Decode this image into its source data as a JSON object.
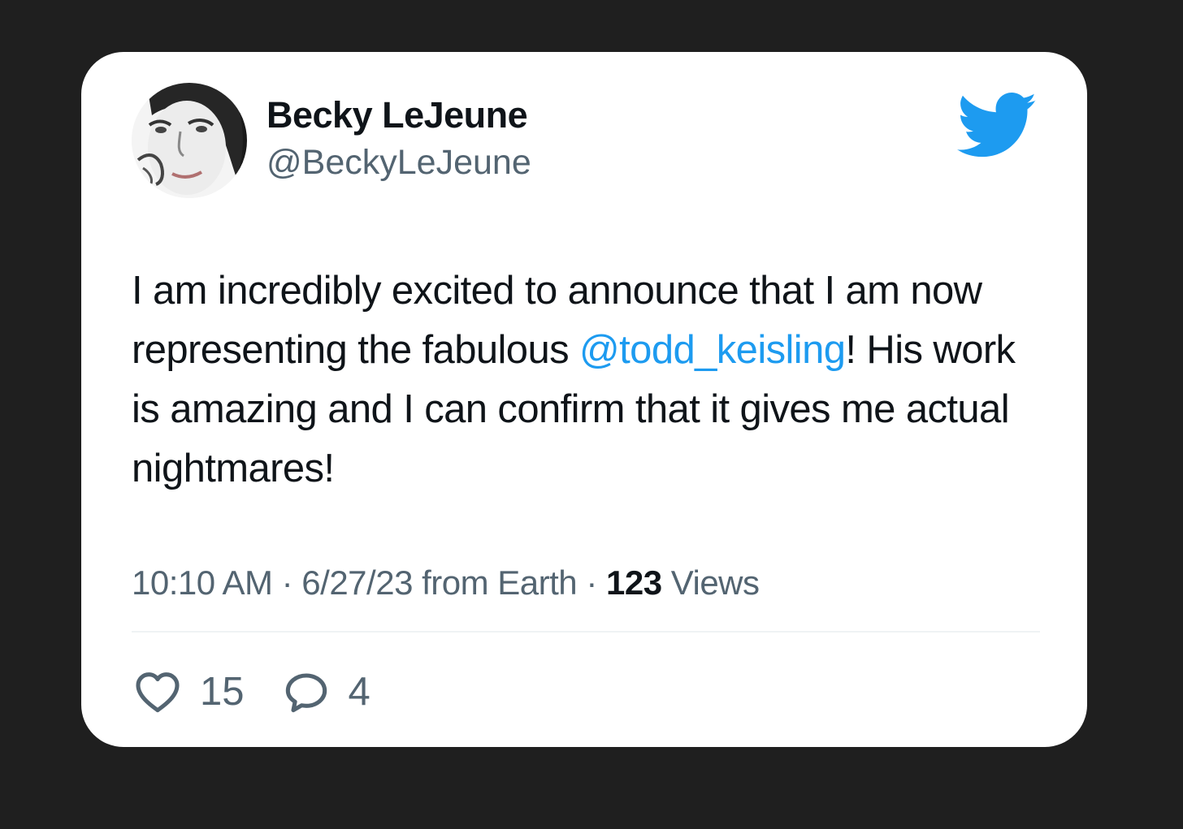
{
  "tweet": {
    "author": {
      "name": "Becky LeJeune",
      "handle": "@BeckyLeJeune",
      "avatar_icon": "profile-photo"
    },
    "brand_icon": "twitter-bird-icon",
    "brand_color": "#1d9bf0",
    "text": {
      "part1": "I am incredibly excited to announce that I am now representing the fabulous ",
      "mention": "@todd_keisling",
      "part2": "! His work is amazing and I can confirm that it gives me actual nightmares!"
    },
    "meta": {
      "time": "10:10 AM",
      "separator1": " · ",
      "date_source": "6/27/23 from Earth",
      "separator2": " · ",
      "views_count": "123",
      "views_label": " Views"
    },
    "actions": {
      "likes": {
        "icon": "heart-icon",
        "count": "15"
      },
      "replies": {
        "icon": "reply-bubble-icon",
        "count": "4"
      }
    }
  }
}
